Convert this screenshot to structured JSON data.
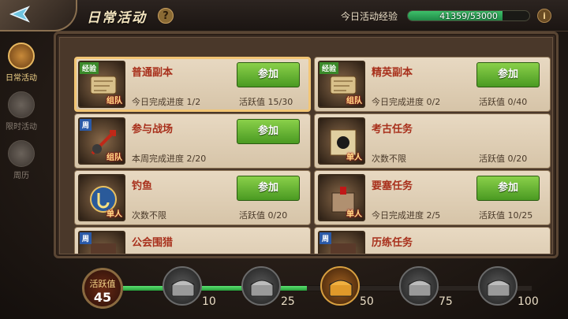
{
  "header": {
    "title": "日常活动",
    "help": "?",
    "exp_label": "今日活动经验",
    "exp_text": "41359/53000",
    "exp_fraction": 0.78,
    "info": "i"
  },
  "tabs": [
    {
      "label": "日常活动",
      "active": true
    },
    {
      "label": "限时活动",
      "active": false
    },
    {
      "label": "周历",
      "active": false
    }
  ],
  "cards": [
    {
      "name": "普通副本",
      "tag": "经验",
      "tag_type": "exp",
      "mode": "组队",
      "progress": "今日完成进度 1/2",
      "activity": "活跃值 15/30",
      "button": "参加",
      "selected": true,
      "icon": "scroll-icon"
    },
    {
      "name": "精英副本",
      "tag": "经验",
      "tag_type": "exp",
      "mode": "组队",
      "progress": "今日完成进度 0/2",
      "activity": "活跃值 0/40",
      "button": "参加",
      "selected": false,
      "icon": "scroll-icon"
    },
    {
      "name": "参与战场",
      "tag": "周",
      "tag_type": "week",
      "mode": "组队",
      "progress": "本周完成进度 2/20",
      "activity": "",
      "button": "参加",
      "selected": false,
      "icon": "sword-icon"
    },
    {
      "name": "考古任务",
      "tag": "",
      "tag_type": "",
      "mode": "单人",
      "progress": "次数不限",
      "activity": "活跃值 0/20",
      "button": "",
      "selected": false,
      "icon": "map-icon"
    },
    {
      "name": "钓鱼",
      "tag": "",
      "tag_type": "",
      "mode": "单人",
      "progress": "次数不限",
      "activity": "活跃值 0/20",
      "button": "参加",
      "selected": false,
      "icon": "fish-hook-icon"
    },
    {
      "name": "要塞任务",
      "tag": "",
      "tag_type": "",
      "mode": "单人",
      "progress": "今日完成进度 2/5",
      "activity": "活跃值 10/25",
      "button": "参加",
      "selected": false,
      "icon": "castle-icon"
    },
    {
      "name": "公会围猎",
      "tag": "周",
      "tag_type": "week",
      "mode": "",
      "progress": "",
      "activity": "",
      "button": "",
      "selected": false,
      "icon": "hunt-icon"
    },
    {
      "name": "历练任务",
      "tag": "周",
      "tag_type": "week",
      "mode": "",
      "progress": "",
      "activity": "",
      "button": "",
      "selected": false,
      "icon": "quest-icon"
    }
  ],
  "rewards": {
    "label": "活跃值",
    "value": "45",
    "progress_fraction": 0.45,
    "chests": [
      {
        "value": "10",
        "open": false
      },
      {
        "value": "25",
        "open": false
      },
      {
        "value": "50",
        "open": true
      },
      {
        "value": "75",
        "open": false
      },
      {
        "value": "100",
        "open": false
      }
    ]
  },
  "colors": {
    "accent": "#f4d58a",
    "button": "#6ab836",
    "exp_bar": "#2fb05a"
  }
}
